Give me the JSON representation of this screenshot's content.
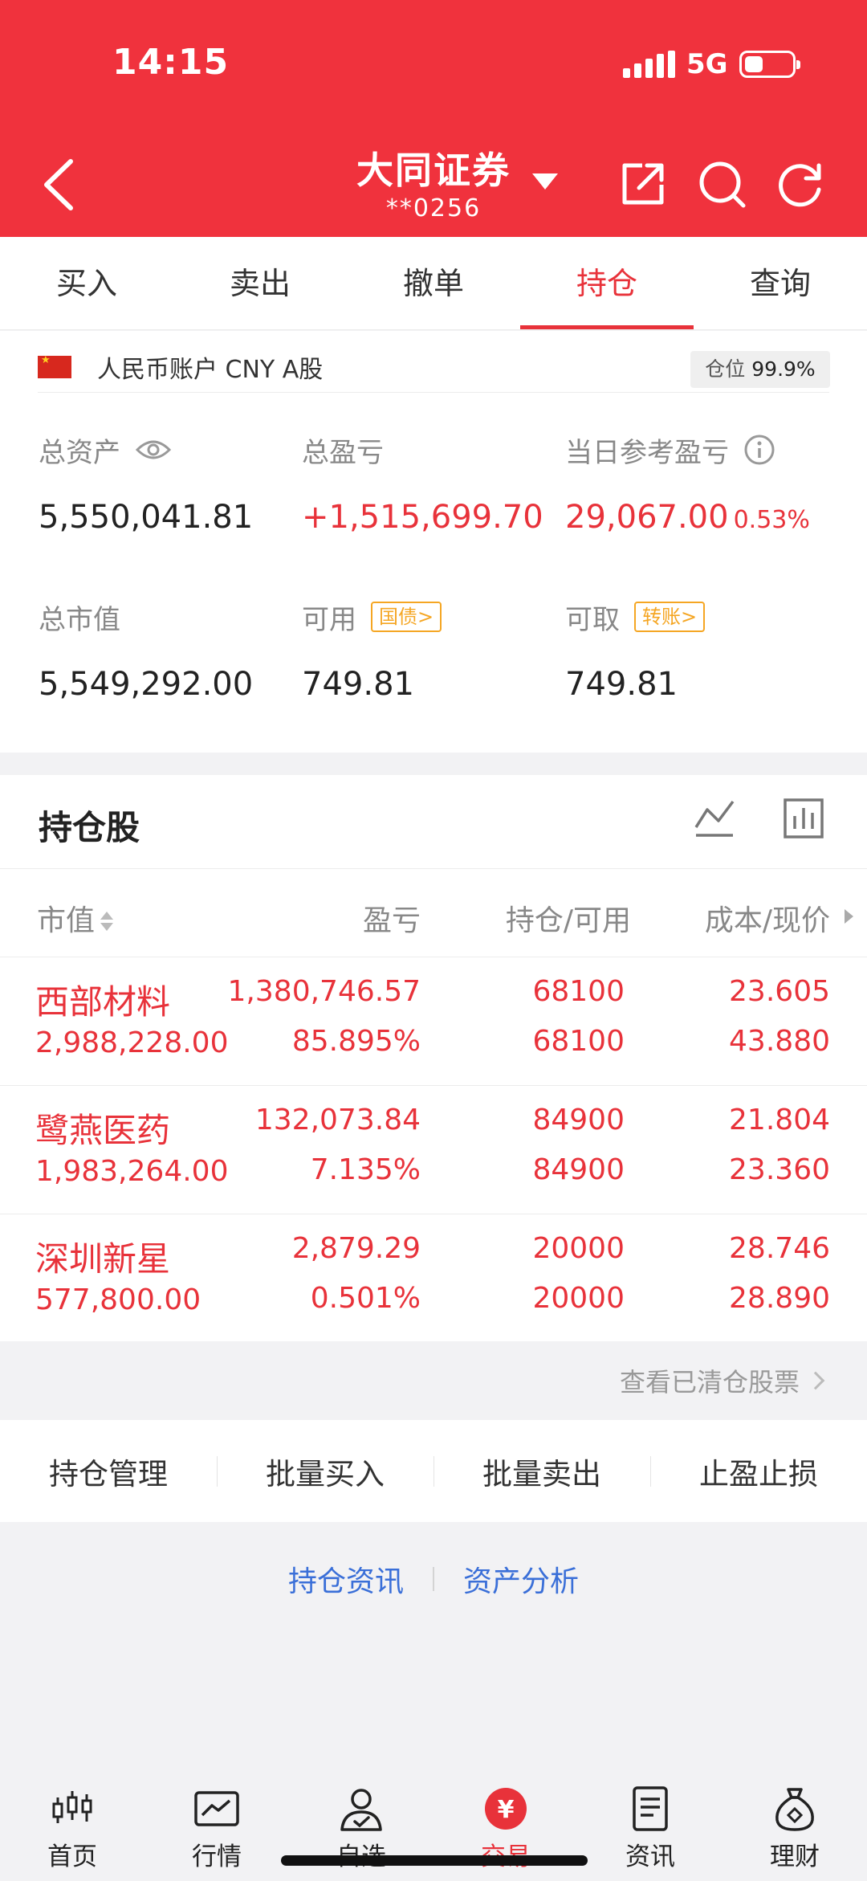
{
  "status_bar": {
    "time": "14:15",
    "network": "5G"
  },
  "header": {
    "broker_name": "大同证券",
    "account_masked": "**0256"
  },
  "tabs": [
    {
      "label": "买入",
      "active": false
    },
    {
      "label": "卖出",
      "active": false
    },
    {
      "label": "撤单",
      "active": false
    },
    {
      "label": "持仓",
      "active": true
    },
    {
      "label": "查询",
      "active": false
    }
  ],
  "account": {
    "label": "人民币账户 CNY A股",
    "position_label": "仓位",
    "position_value": "99.9%",
    "total_assets_label": "总资产",
    "total_assets": "5,550,041.81",
    "total_pnl_label": "总盈亏",
    "total_pnl": "+1,515,699.70",
    "daily_pnl_label": "当日参考盈亏",
    "daily_pnl": "29,067.00",
    "daily_pnl_pct": "0.53%",
    "market_value_label": "总市值",
    "market_value": "5,549,292.00",
    "available_label": "可用",
    "available_tag": "国债>",
    "available": "749.81",
    "withdrawable_label": "可取",
    "withdrawable_tag": "转账>",
    "withdrawable": "749.81"
  },
  "holdings": {
    "title": "持仓股",
    "columns": [
      "市值",
      "盈亏",
      "持仓/可用",
      "成本/现价"
    ],
    "rows": [
      {
        "name": "西部材料",
        "market_value": "2,988,228.00",
        "pnl": "1,380,746.57",
        "pnl_pct": "85.895%",
        "position": "68100",
        "available": "68100",
        "cost": "23.605",
        "price": "43.880"
      },
      {
        "name": "鹭燕医药",
        "market_value": "1,983,264.00",
        "pnl": "132,073.84",
        "pnl_pct": "7.135%",
        "position": "84900",
        "available": "84900",
        "cost": "21.804",
        "price": "23.360"
      },
      {
        "name": "深圳新星",
        "market_value": "577,800.00",
        "pnl": "2,879.29",
        "pnl_pct": "0.501%",
        "position": "20000",
        "available": "20000",
        "cost": "28.746",
        "price": "28.890"
      }
    ],
    "cleared_link": "查看已清仓股票"
  },
  "actions": [
    "持仓管理",
    "批量买入",
    "批量卖出",
    "止盈止损"
  ],
  "links": [
    "持仓资讯",
    "资产分析"
  ],
  "bottom_nav": [
    {
      "label": "首页",
      "icon": "candlestick-icon"
    },
    {
      "label": "行情",
      "icon": "market-chart-icon"
    },
    {
      "label": "自选",
      "icon": "user-check-icon"
    },
    {
      "label": "交易",
      "icon": "yuan-coin-icon",
      "active": true
    },
    {
      "label": "资讯",
      "icon": "document-icon"
    },
    {
      "label": "理财",
      "icon": "money-bag-icon"
    }
  ],
  "colors": {
    "brand_red": "#f0323d",
    "gain_red": "#e8323a",
    "link_blue": "#3a6fd8",
    "tag_orange": "#f5a623"
  }
}
